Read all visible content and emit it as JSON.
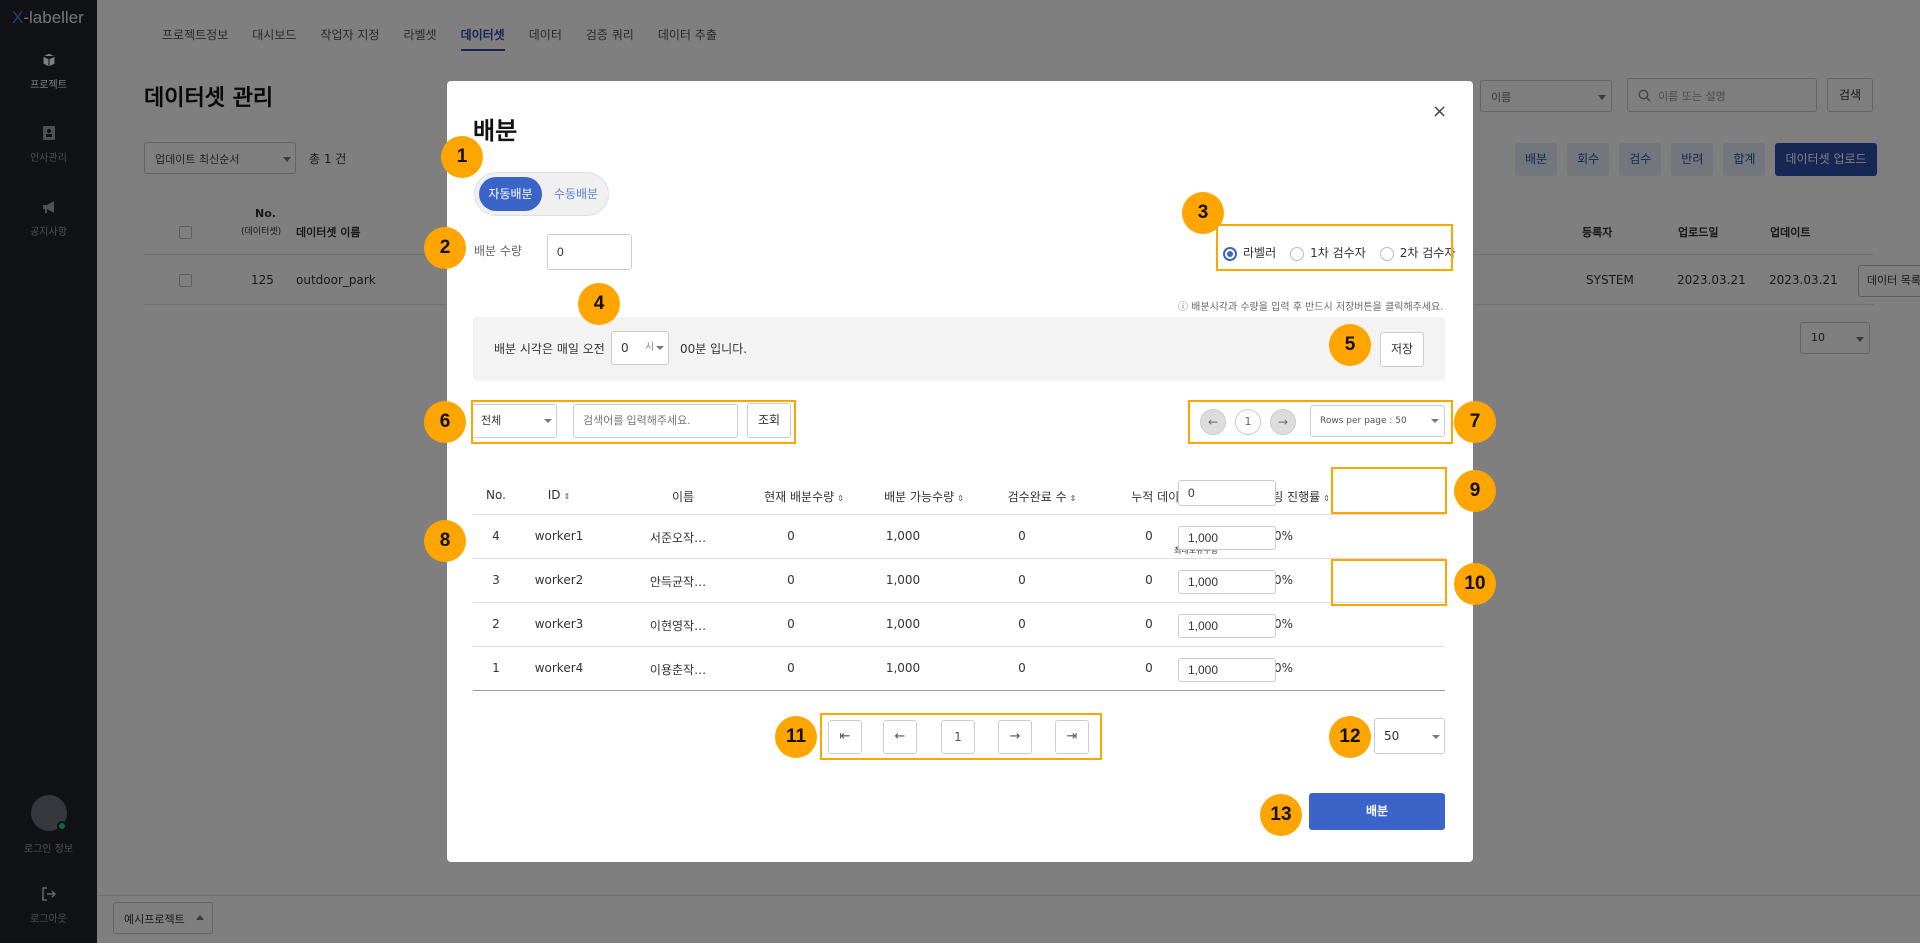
{
  "sidebar": {
    "logo_x": "X",
    "logo_rest": "-labeller",
    "items": [
      {
        "label": "프로젝트",
        "icon": "cube-icon"
      },
      {
        "label": "인사관리",
        "icon": "id-card-icon"
      },
      {
        "label": "공지사항",
        "icon": "megaphone-icon"
      }
    ],
    "login_label": "로그인 정보",
    "logout_label": "로그아웃"
  },
  "tabs": [
    "프로젝트정보",
    "대시보드",
    "작업자 지정",
    "라벨셋",
    "데이터셋",
    "데이터",
    "검증 쿼리",
    "데이터 추출"
  ],
  "page": {
    "title": "데이터셋 관리",
    "sort": "업데이트 최신순서",
    "total": "총 1 건",
    "filter_select": "이름",
    "search_placeholder": "이름 또는 설명",
    "search_button": "검색",
    "actions": [
      "배분",
      "회수",
      "검수",
      "반려",
      "합계",
      "데이터셋 업로드"
    ],
    "columns": {
      "no": "No.",
      "no_sub": "(데이터셋)",
      "name": "데이터셋 이름",
      "creator": "등록자",
      "uploaded": "업로드일",
      "updated": "업데이트"
    },
    "row": {
      "no": "125",
      "name": "outdoor_park",
      "creator": "SYSTEM",
      "uploaded": "2023.03.21",
      "updated": "2023.03.21",
      "list_button": "데이터 목록"
    },
    "page_size": "10",
    "project_select": "예시프로젝트"
  },
  "modal": {
    "title": "배분",
    "close": "×",
    "mode_auto": "자동배분",
    "mode_manual": "수동배분",
    "quantity_label": "배분 수량",
    "quantity_value": "0",
    "roles": [
      "라벨러",
      "1차 검수자",
      "2차 검수자"
    ],
    "notice": "ⓘ 배분시각과 수량을 입력 후 반드시 저장버튼을 클릭해주세요.",
    "time_prefix": "배분 시각은 매일 오전",
    "hour_value": "0",
    "hour_unit": "시",
    "time_suffix": "00분 입니다.",
    "save_button": "저장",
    "search_filter": "전체",
    "search_placeholder": "검색어를 입력해주세요.",
    "search_button": "조회",
    "top_page": "1",
    "rows_per_page": "Rows per page : 50",
    "headers": [
      "No.",
      "ID",
      "이름",
      "현재 배분수량",
      "배분 가능수량",
      "검수완료 수",
      "누적 데이터 수",
      "라벨링 진행률"
    ],
    "max_caption": "최대보유수량",
    "max_all_value": "0",
    "rows": [
      {
        "no": "4",
        "id": "worker1",
        "name": "서준오작…",
        "current": "0",
        "available": "1,000",
        "reviewed": "0",
        "cumulative": "0",
        "progress": "0.00%",
        "max": "1,000"
      },
      {
        "no": "3",
        "id": "worker2",
        "name": "안득균작…",
        "current": "0",
        "available": "1,000",
        "reviewed": "0",
        "cumulative": "0",
        "progress": "0.00%",
        "max": "1,000"
      },
      {
        "no": "2",
        "id": "worker3",
        "name": "이현영작…",
        "current": "0",
        "available": "1,000",
        "reviewed": "0",
        "cumulative": "0",
        "progress": "0.00%",
        "max": "1,000"
      },
      {
        "no": "1",
        "id": "worker4",
        "name": "이용춘작…",
        "current": "0",
        "available": "1,000",
        "reviewed": "0",
        "cumulative": "0",
        "progress": "0.00%",
        "max": "1,000"
      }
    ],
    "bottom_page": "1",
    "page_size": "50",
    "submit_button": "배분"
  },
  "annotations": [
    "1",
    "2",
    "3",
    "4",
    "5",
    "6",
    "7",
    "8",
    "9",
    "10",
    "11",
    "12",
    "13"
  ],
  "colors": {
    "accent": "#3a64c7",
    "annotation": "#ffa500",
    "sidebar": "#22252d"
  }
}
